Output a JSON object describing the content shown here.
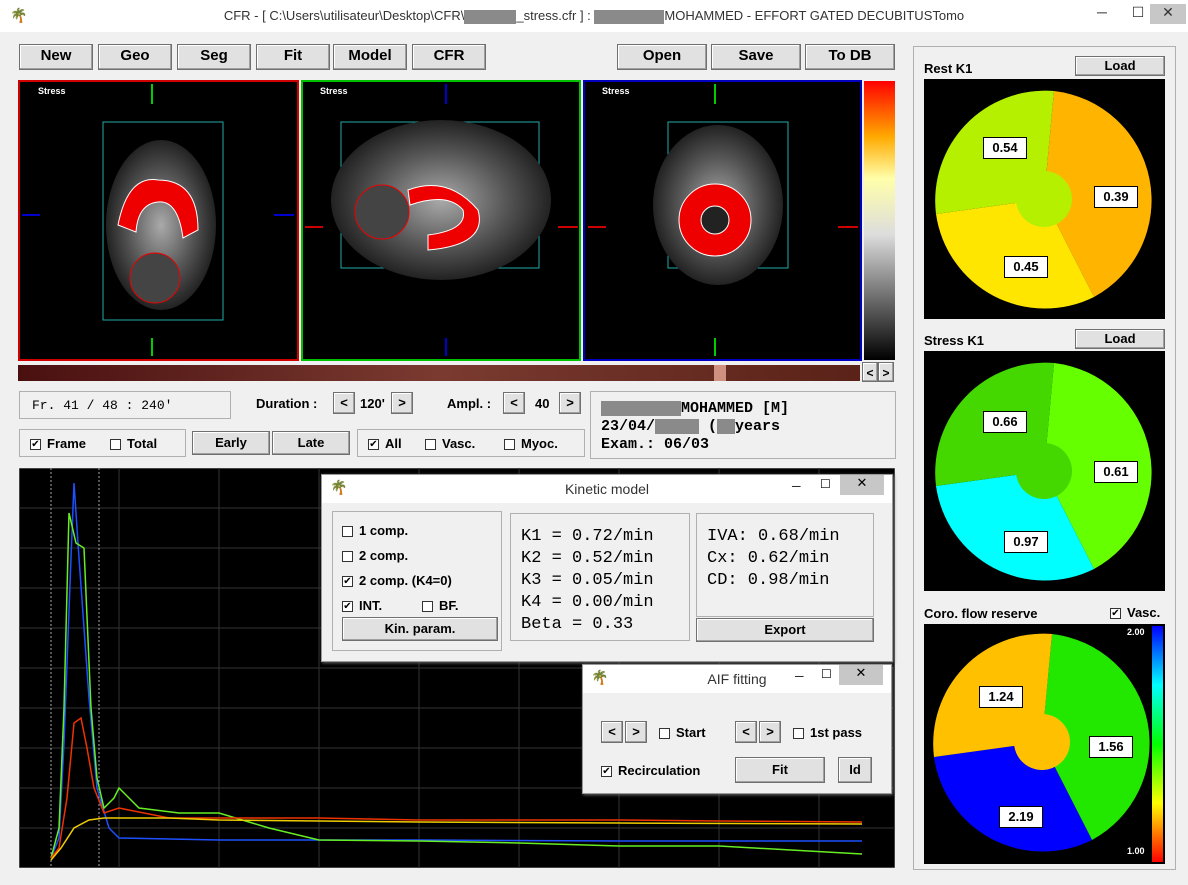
{
  "window": {
    "title_prefix": "CFR - [ C:\\Users\\utilisateur\\Desktop\\CFR\\",
    "title_mid": "_stress.cfr ] :",
    "title_suffix": "MOHAMMED   - EFFORT GATED DECUBITUSTomo",
    "min": "─",
    "max": "☐",
    "close": "✕"
  },
  "toolbar": {
    "new": "New",
    "geo": "Geo",
    "seg": "Seg",
    "fit": "Fit",
    "model": "Model",
    "cfr": "CFR",
    "open": "Open",
    "save": "Save",
    "todb": "To DB"
  },
  "viewers": {
    "label1": "Stress",
    "label2": "Stress",
    "label3": "Stress"
  },
  "frame": {
    "text": "Fr. 41 / 48 : 240'",
    "duration_label": "Duration :",
    "duration_value": "120'",
    "ampl_label": "Ampl. :",
    "ampl_value": "40"
  },
  "nav": {
    "prev": "<",
    "next": ">"
  },
  "filters": {
    "frame": "Frame",
    "total": "Total",
    "early": "Early",
    "late": "Late",
    "all": "All",
    "vasc": "Vasc.",
    "myoc": "Myoc."
  },
  "patient": {
    "name": "MOHAMMED",
    "sex": "[M]",
    "dob": "23/04/",
    "years": "years",
    "exam": "Exam.: 06/03"
  },
  "kinetic": {
    "title": "Kinetic model",
    "opt1": "1 comp.",
    "opt2": "2 comp.",
    "opt3": "2 comp. (K4=0)",
    "int": "INT.",
    "bf": "BF.",
    "kin_param": "Kin. param.",
    "k1": "K1 = 0.72/min",
    "k2": "K2 = 0.52/min",
    "k3": "K3 = 0.05/min",
    "k4": "K4 = 0.00/min",
    "beta": "Beta = 0.33",
    "iva": "IVA: 0.68/min",
    "cx": "Cx: 0.62/min",
    "cd": "CD: 0.98/min",
    "export": "Export"
  },
  "aif": {
    "title": "AIF fitting",
    "start": "Start",
    "first_pass": "1st pass",
    "recirc": "Recirculation",
    "fit": "Fit",
    "id": "Id"
  },
  "right": {
    "rest_title": "Rest K1",
    "stress_title": "Stress K1",
    "cfr_title": "Coro. flow reserve",
    "load": "Load",
    "vasc": "Vasc.",
    "scale_max": "2.00",
    "scale_min": "1.00",
    "rest": {
      "a": "0.54",
      "b": "0.39",
      "c": "0.45"
    },
    "stress": {
      "a": "0.66",
      "b": "0.61",
      "c": "0.97"
    },
    "cfr": {
      "a": "1.24",
      "b": "1.56",
      "c": "2.19"
    }
  },
  "colors": {
    "yellowgreen": "#b4f000",
    "orange": "#ffb400",
    "yellow": "#ffe600",
    "green": "#44d800",
    "lgreen": "#66ff00",
    "cyan": "#00ffff",
    "amber": "#ffc000",
    "blue": "#0000ff"
  }
}
